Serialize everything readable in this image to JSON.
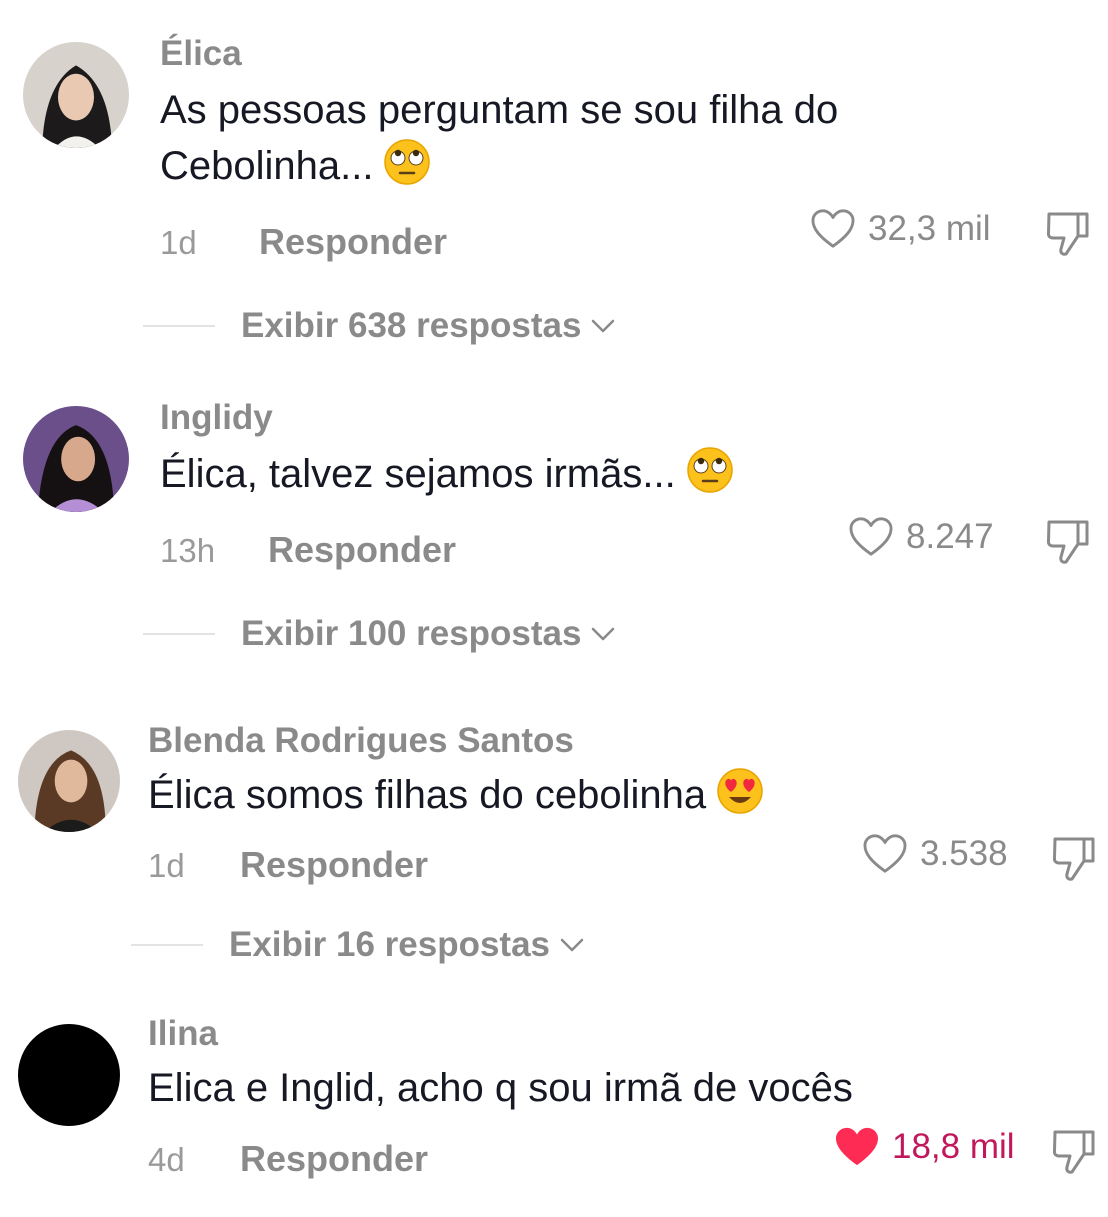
{
  "comments": [
    {
      "username": "Élica",
      "text_lines": [
        "As pessoas perguntam se sou filha do",
        "Cebolinha..."
      ],
      "emoji": "face-with-rolling-eyes",
      "time": "1d",
      "reply_label": "Responder",
      "likes": "32,3 mil",
      "liked": false,
      "view_replies": "Exibir 638 respostas"
    },
    {
      "username": "Inglidy",
      "text_lines": [
        "Élica, talvez sejamos irmãs..."
      ],
      "emoji": "face-with-rolling-eyes",
      "time": "13h",
      "reply_label": "Responder",
      "likes": "8.247",
      "liked": false,
      "view_replies": "Exibir 100 respostas"
    },
    {
      "username": "Blenda Rodrigues Santos",
      "text_lines": [
        "Élica somos filhas do cebolinha"
      ],
      "emoji": "smiling-face-with-heart-eyes",
      "time": "1d",
      "reply_label": "Responder",
      "likes": "3.538",
      "liked": false,
      "view_replies": "Exibir 16 respostas"
    },
    {
      "username": "Ilina",
      "text_lines": [
        "Elica e Inglid, acho q sou irmã de vocês"
      ],
      "emoji": "",
      "time": "4d",
      "reply_label": "Responder",
      "likes": "18,8 mil",
      "liked": true,
      "view_replies": ""
    }
  ],
  "colors": {
    "text": "#161823",
    "muted": "#8a8a8a",
    "liked_heart": "#fe2c55",
    "liked_count": "#c2185b"
  }
}
